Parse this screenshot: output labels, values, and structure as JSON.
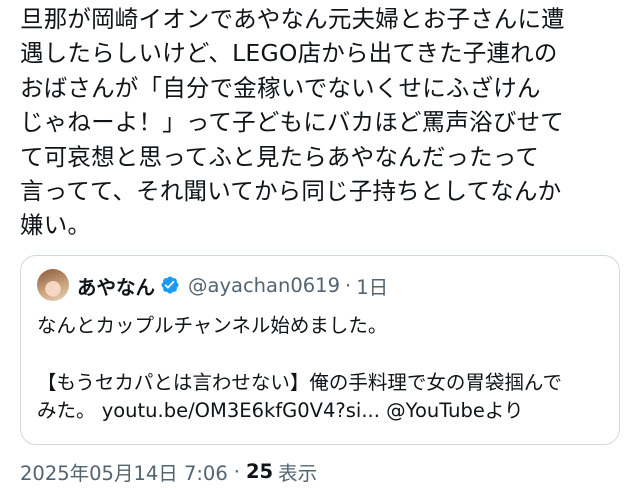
{
  "tweet": {
    "lines": [
      "旦那が岡崎イオンであやなん元夫婦とお子さんに遭",
      "遇したらしいけど、LEGO店から出てきた子連れの",
      "おばさんが「自分で金稼いでないくせにふざけん",
      "じゃねーよ！」って子どもにバカほど罵声浴びせて",
      "て可哀想と思ってふと見たらあやなんだったって",
      "言ってて、それ聞いてから同じ子持ちとしてなんか",
      "嫌い。"
    ]
  },
  "quote": {
    "display_name": "あやなん",
    "handle": "@ayachan0619",
    "separator": "·",
    "time_ago": "1日",
    "verified_color": "#1d9bf0",
    "avatar_icon": "user-avatar-photo",
    "body_line_1": "なんとカップルチャンネル始めました。",
    "body_line_2": "【もうセカパとは言わせない】俺の手料理で女の胃袋掴んで",
    "body_line_3": "みた。 youtu.be/OM3E6kfG0V4?si... @YouTubeより"
  },
  "footer": {
    "timestamp": "2025年05月14日 7:06",
    "separator": "·",
    "views_count": "25",
    "views_label": "表示"
  }
}
